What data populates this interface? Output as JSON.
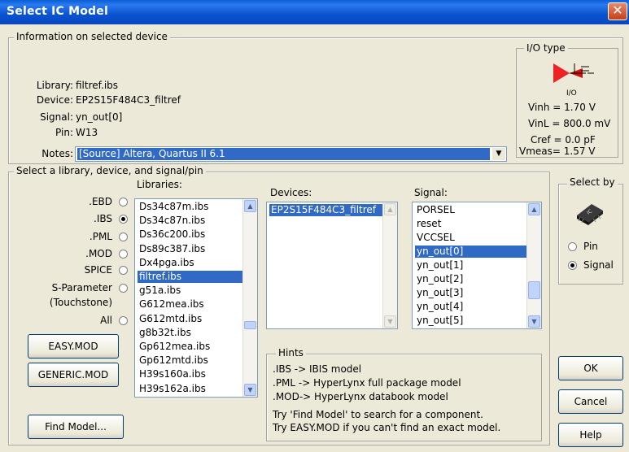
{
  "window": {
    "title": "Select IC Model",
    "close_glyph": "✕"
  },
  "info": {
    "legend": "Information on selected device",
    "library_label": "Library:",
    "library_value": "filtref.ibs",
    "device_label": "Device:",
    "device_value": "EP2S15F484C3_filtref",
    "signal_label": "Signal:",
    "signal_value": "yn_out[0]",
    "pin_label": "Pin:",
    "pin_value": "W13",
    "notes_label": "Notes:",
    "notes_value": "[Source] Altera, Quartus II 6.1"
  },
  "io_type": {
    "legend": "I/O type",
    "icon_caption": "I/O",
    "vinh": "Vinh = 1.70 V",
    "vinl": "VinL = 800.0 mV",
    "cref": "Cref = 0.0 pF",
    "vmeas": "Vmeas= 1.57 V"
  },
  "select": {
    "legend": "Select a library, device, and signal/pin",
    "types": [
      {
        "label": ".EBD",
        "selected": false
      },
      {
        "label": ".IBS",
        "selected": true
      },
      {
        "label": ".PML",
        "selected": false
      },
      {
        "label": ".MOD",
        "selected": false
      },
      {
        "label": "SPICE",
        "selected": false
      },
      {
        "label": "S-Parameter",
        "selected": false
      },
      {
        "label": "(Touchstone)",
        "selected": false
      },
      {
        "label": "All",
        "selected": false
      }
    ],
    "libraries_label": "Libraries:",
    "libraries": [
      "Ds34c87m.ibs",
      "Ds34c87n.ibs",
      "Ds36c200.ibs",
      "Ds89c387.ibs",
      "Dx4pga.ibs",
      "filtref.ibs",
      "g51a.ibs",
      "G612mea.ibs",
      "G612mtd.ibs",
      "g8b32t.ibs",
      "Gp612mea.ibs",
      "Gp612mtd.ibs",
      "H39s160a.ibs",
      "H39s162a.ibs"
    ],
    "libraries_selected": "filtref.ibs",
    "devices_label": "Devices:",
    "devices": [
      "EP2S15F484C3_filtref"
    ],
    "signal_label": "Signal:",
    "signals": [
      "PORSEL",
      "reset",
      "VCCSEL",
      "yn_out[0]",
      "yn_out[1]",
      "yn_out[2]",
      "yn_out[3]",
      "yn_out[4]",
      "yn_out[5]"
    ],
    "signals_selected": "yn_out[0]"
  },
  "select_by": {
    "legend": "Select by",
    "pin_label": "Pin",
    "pin_selected": false,
    "signal_label": "Signal",
    "signal_selected": true
  },
  "hints": {
    "legend": "Hints",
    "lines": [
      ".IBS  -> IBIS model",
      ".PML -> HyperLynx full package model",
      ".MOD-> HyperLynx databook model",
      "Try 'Find Model' to search for a component.",
      "Try EASY.MOD if you can't find an exact model."
    ]
  },
  "buttons": {
    "easy_mod": "EASY.MOD",
    "generic_mod": "GENERIC.MOD",
    "find_model": "Find Model...",
    "ok": "OK",
    "cancel": "Cancel",
    "help": "Help"
  }
}
